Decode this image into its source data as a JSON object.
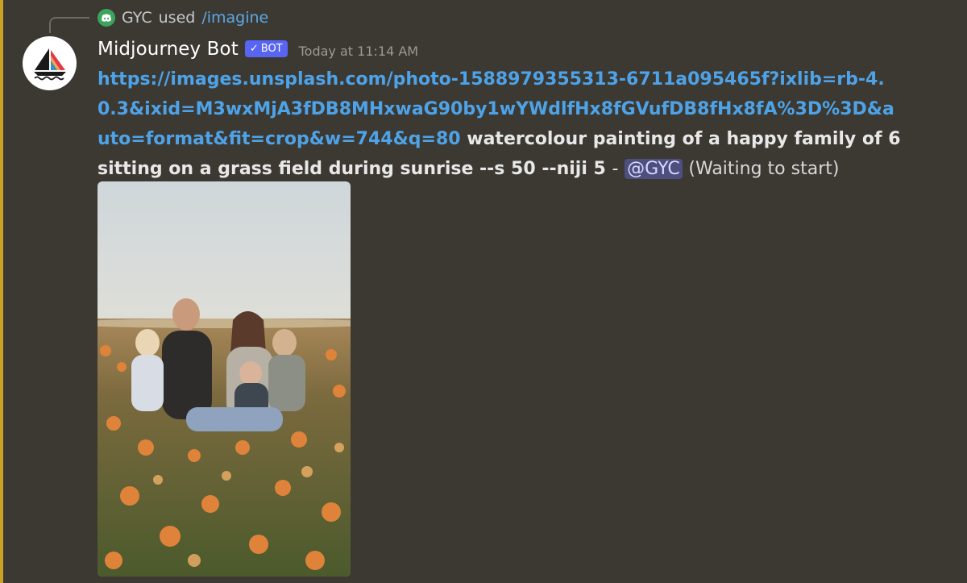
{
  "reply": {
    "user": "GYC",
    "used_text": "used",
    "command": "/imagine",
    "icon": "discord-avatar-icon"
  },
  "author": {
    "name": "Midjourney Bot",
    "badge": "BOT",
    "badge_check": "✓",
    "timestamp": "Today at 11:14 AM",
    "avatar_icon": "sailboat-logo-icon"
  },
  "message": {
    "link": "https://images.unsplash.com/photo-1588979355313-6711a095465f?ixlib=rb-4.0.3&ixid=M3wxMjA3fDB8MHxwaG90by1wYWdlfHx8fGVufDB8fHx8fA%3D%3D&auto=format&fit=crop&w=744&q=80",
    "prompt": "watercolour painting of a happy family of 6 sitting on a grass field during sunrise --s 50 --niji 5",
    "separator": "-",
    "mention": "@GYC",
    "status": "(Waiting to start)"
  },
  "colors": {
    "background": "#3c3933",
    "accent_bar": "#c9a227",
    "link": "#4ea3e8",
    "badge": "#5865f2",
    "mention_bg": "#4e4f7e"
  },
  "attachment": {
    "icon": "family-photo-image"
  }
}
